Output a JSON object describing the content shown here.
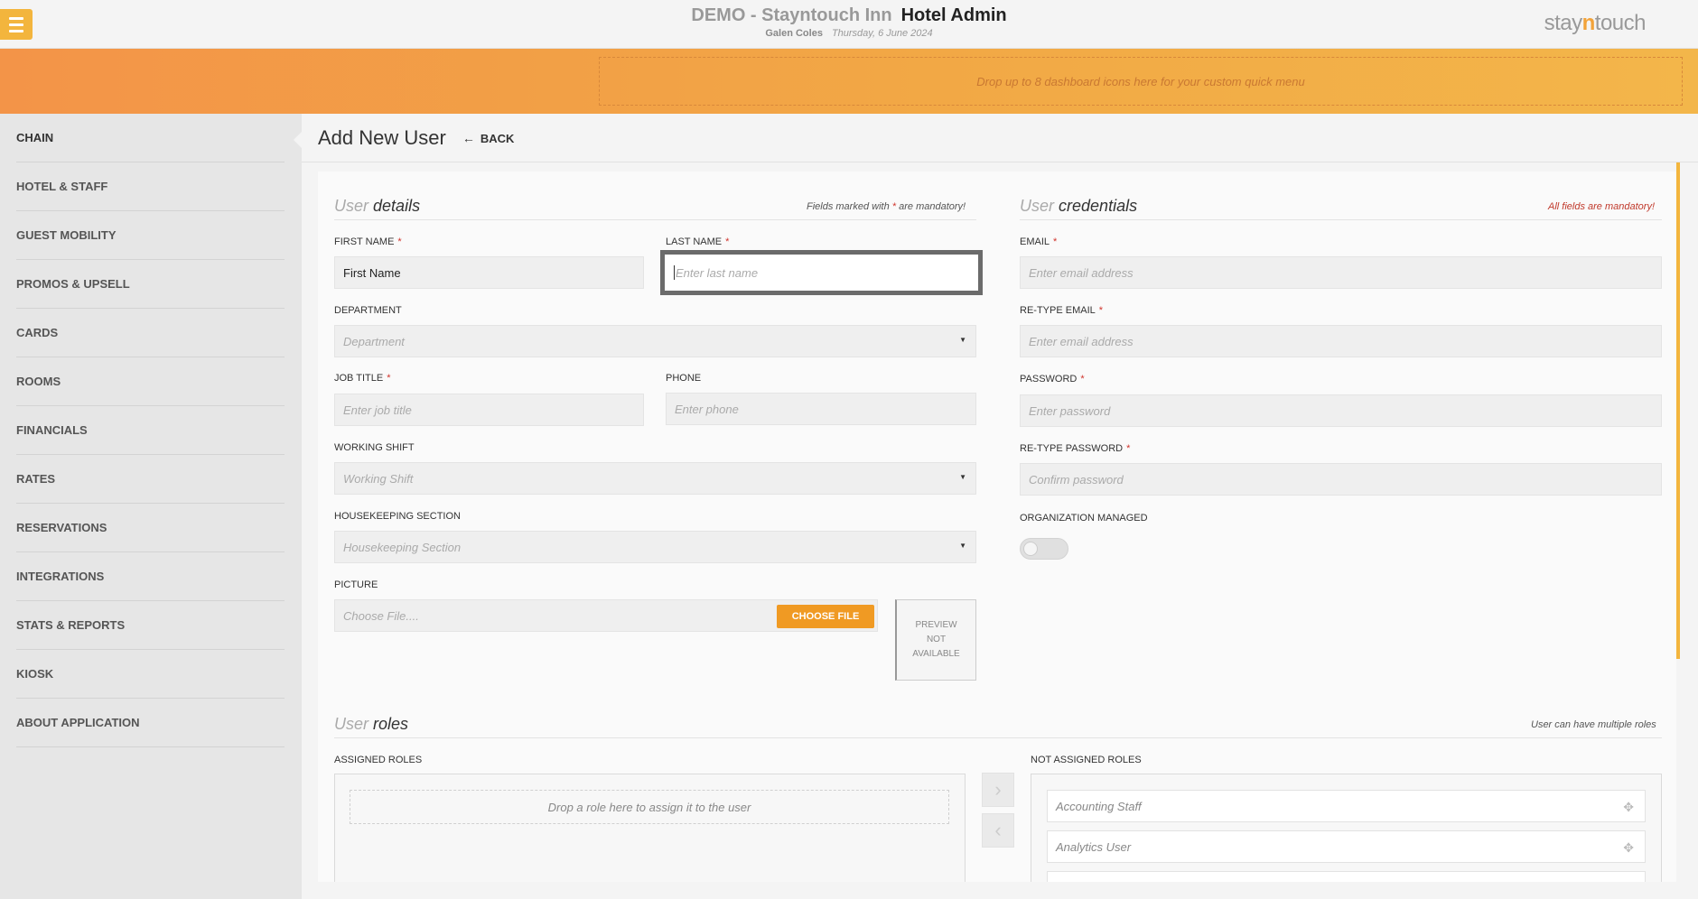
{
  "header": {
    "menu_icon": "hamburger-menu-icon",
    "property": "DEMO - Stayntouch Inn",
    "app_title": "Hotel Admin",
    "user_name": "Galen Coles",
    "date": "Thursday, 6 June 2024",
    "logo_prefix": "stay",
    "logo_mid": "n",
    "logo_suffix": "touch"
  },
  "quick_menu": {
    "placeholder": "Drop up to 8 dashboard icons here for your custom quick menu"
  },
  "sidebar": {
    "items": [
      {
        "label": "CHAIN",
        "active": true
      },
      {
        "label": "HOTEL & STAFF"
      },
      {
        "label": "GUEST MOBILITY"
      },
      {
        "label": "PROMOS & UPSELL"
      },
      {
        "label": "CARDS"
      },
      {
        "label": "ROOMS"
      },
      {
        "label": "FINANCIALS"
      },
      {
        "label": "RATES"
      },
      {
        "label": "RESERVATIONS"
      },
      {
        "label": "INTEGRATIONS"
      },
      {
        "label": "STATS & REPORTS"
      },
      {
        "label": "KIOSK"
      },
      {
        "label": "ABOUT APPLICATION"
      }
    ]
  },
  "page": {
    "title": "Add New User",
    "back_label": "BACK",
    "back_icon": "arrow-left-icon"
  },
  "user_details": {
    "title_light": "User",
    "title_strong": "details",
    "mandatory_note_pre": "Fields marked with",
    "mandatory_star": "*",
    "mandatory_note_post": "are mandatory!",
    "first_name": {
      "label": "FIRST NAME",
      "value": "First Name"
    },
    "last_name": {
      "label": "LAST NAME",
      "placeholder": "Enter last name"
    },
    "department": {
      "label": "DEPARTMENT",
      "placeholder": "Department"
    },
    "job_title": {
      "label": "JOB TITLE",
      "placeholder": "Enter job title"
    },
    "phone": {
      "label": "PHONE",
      "placeholder": "Enter phone"
    },
    "working_shift": {
      "label": "WORKING SHIFT",
      "placeholder": "Working Shift"
    },
    "housekeeping": {
      "label": "HOUSEKEEPING SECTION",
      "placeholder": "Housekeeping Section"
    },
    "picture": {
      "label": "PICTURE",
      "placeholder": "Choose File....",
      "button": "CHOOSE FILE",
      "preview": "PREVIEW NOT AVAILABLE"
    }
  },
  "credentials": {
    "title_light": "User",
    "title_strong": "credentials",
    "note": "All fields are mandatory!",
    "email": {
      "label": "EMAIL",
      "placeholder": "Enter email address"
    },
    "retype_email": {
      "label": "RE-TYPE EMAIL",
      "placeholder": "Enter email address"
    },
    "password": {
      "label": "PASSWORD",
      "placeholder": "Enter password"
    },
    "retype_password": {
      "label": "RE-TYPE PASSWORD",
      "placeholder": "Confirm password"
    },
    "org_managed": {
      "label": "ORGANIZATION MANAGED",
      "on": false
    }
  },
  "roles": {
    "title_light": "User",
    "title_strong": "roles",
    "note": "User can have multiple roles",
    "assigned_label": "ASSIGNED ROLES",
    "drop_hint": "Drop a role here to assign it to the user",
    "not_assigned_label": "NOT ASSIGNED ROLES",
    "available": [
      "Accounting Staff",
      "Analytics User"
    ],
    "move_right_icon": "chevron-right-icon",
    "move_left_icon": "chevron-left-icon"
  },
  "colors": {
    "accent": "#f3b53d",
    "button": "#f09a23",
    "required": "#d0342c"
  }
}
